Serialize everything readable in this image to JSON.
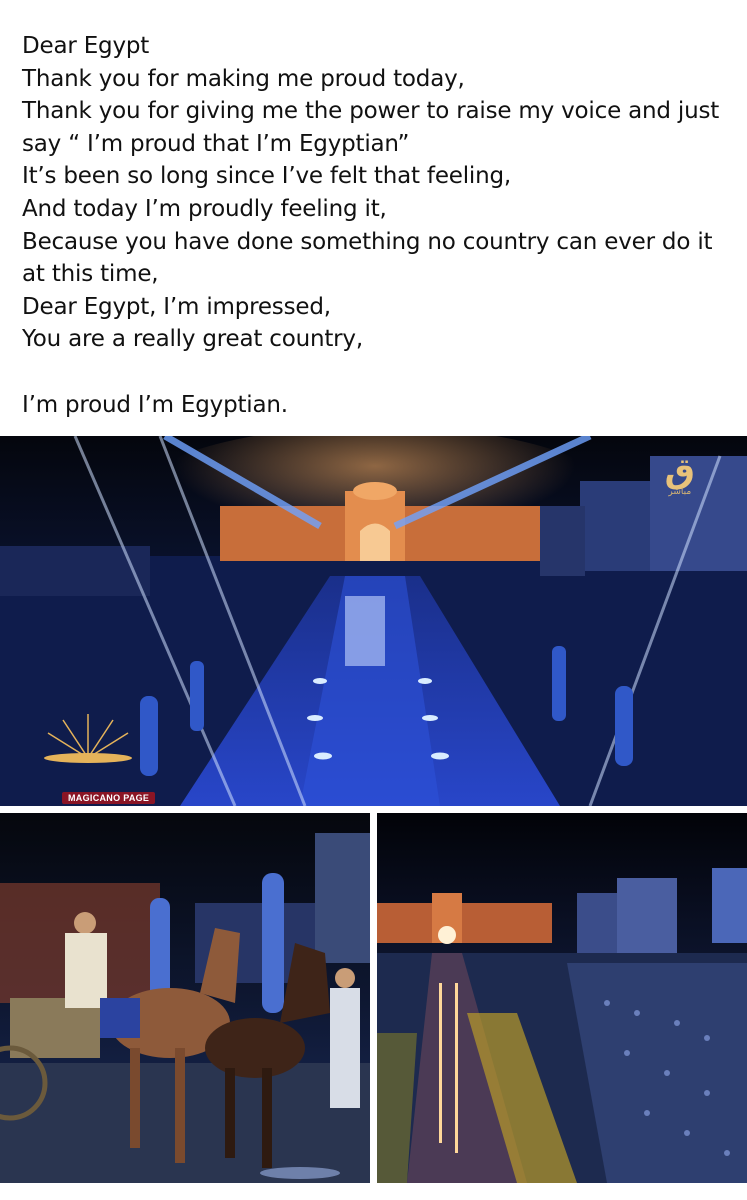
{
  "post": {
    "lines": [
      "Dear Egypt",
      "Thank you for making me proud today,",
      "Thank you for giving me the power to raise my voice and just say “ I’m proud that I’m Egyptian”",
      "It’s been so long since I’ve felt that feeling,",
      "And today I’m proudly feeling it,",
      "Because you have done something no country can ever do it at this time,",
      "Dear Egypt, I’m impressed,",
      "You are a really great country,",
      "I’m proud I’m Egyptian."
    ]
  },
  "photos": {
    "top": {
      "logo_text": "ق",
      "logo_subtext": "مباشر",
      "watermark": "MAGICANO PAGE"
    }
  },
  "colors": {
    "night_sky": "#05070f",
    "stage_blue": "#1d3fb8",
    "museum_orange": "#d9793f",
    "light_gold": "#e8c27a"
  }
}
